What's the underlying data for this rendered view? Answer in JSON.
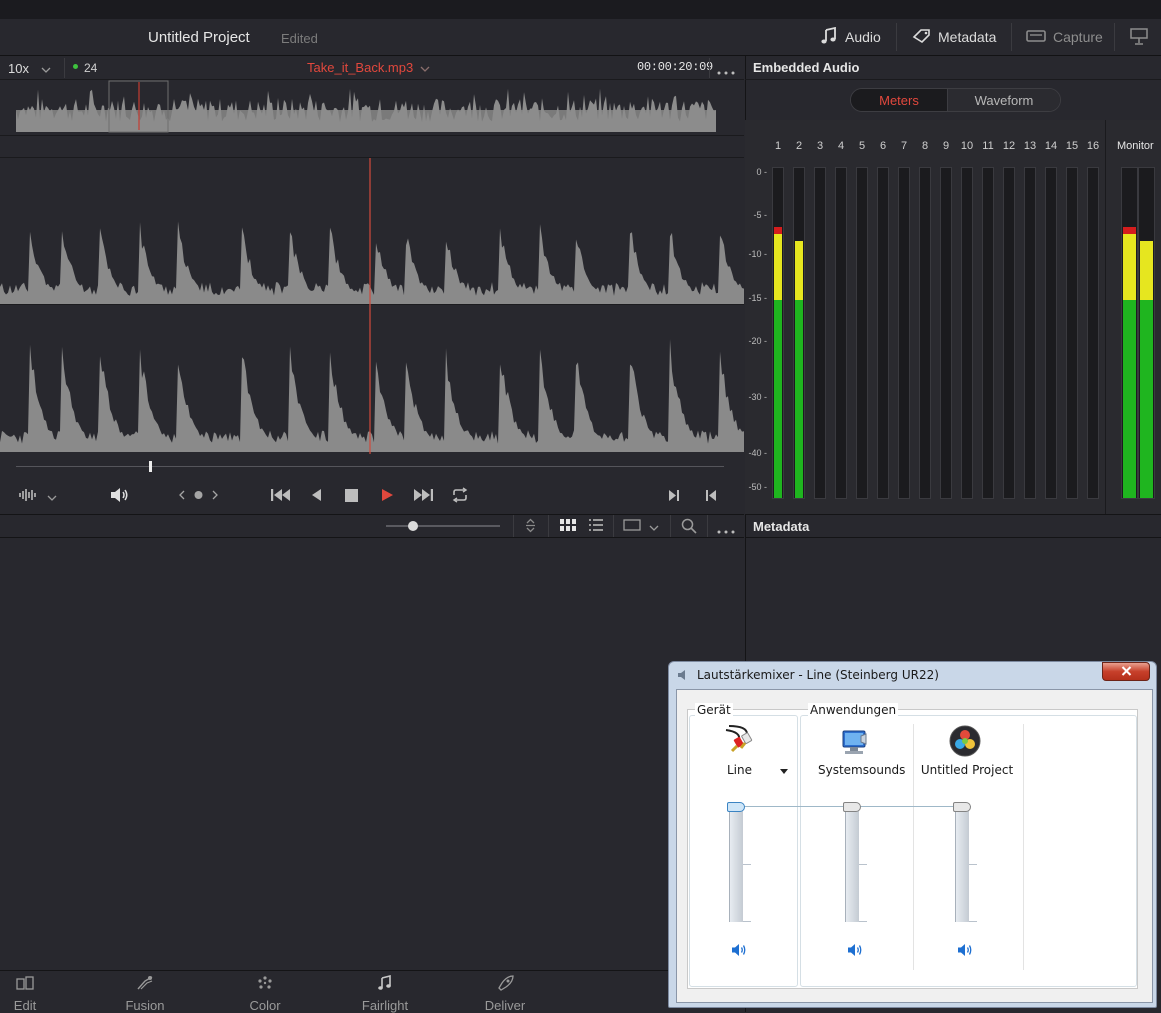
{
  "header": {
    "project_title": "Untitled Project",
    "project_status": "Edited",
    "buttons": [
      {
        "label": "Audio",
        "icon": "music-note-icon"
      },
      {
        "label": "Metadata",
        "icon": "tag-icon"
      },
      {
        "label": "Capture",
        "icon": "capture-device-icon"
      }
    ]
  },
  "viewer": {
    "zoom": "10x",
    "fps": "24",
    "clip_name": "Take_it_Back.mp3",
    "timecode": "00:00:20:09"
  },
  "embedded_audio": {
    "title": "Embedded Audio",
    "tabs": [
      "Meters",
      "Waveform"
    ],
    "active_tab": "Meters",
    "channels": [
      "1",
      "2",
      "3",
      "4",
      "5",
      "6",
      "7",
      "8",
      "9",
      "10",
      "11",
      "12",
      "13",
      "14",
      "15",
      "16"
    ],
    "monitor_label": "Monitor",
    "db_scale": [
      "0",
      "-5",
      "-10",
      "-15",
      "-20",
      "-30",
      "-40",
      "-50"
    ],
    "channel_levels": [
      0.82,
      0.78,
      0,
      0,
      0,
      0,
      0,
      0,
      0,
      0,
      0,
      0,
      0,
      0,
      0,
      0
    ],
    "monitor_levels": [
      0.82,
      0.78
    ]
  },
  "metadata_panel": {
    "title": "Metadata"
  },
  "pages": [
    "Edit",
    "Fusion",
    "Color",
    "Fairlight",
    "Deliver"
  ],
  "mixer_dialog": {
    "title": "Lautstärkemixer - Line (Steinberg UR22)",
    "device_group": "Gerät",
    "apps_group": "Anwendungen",
    "device_name": "Line",
    "apps": [
      "Systemsounds",
      "Untitled Project"
    ],
    "volume_levels": [
      1.0,
      1.0,
      1.0
    ]
  },
  "colors": {
    "accent_red": "#e2483d",
    "meter_green": "#1fb51f",
    "meter_yellow": "#e6e61f",
    "meter_red": "#d41d1d"
  }
}
